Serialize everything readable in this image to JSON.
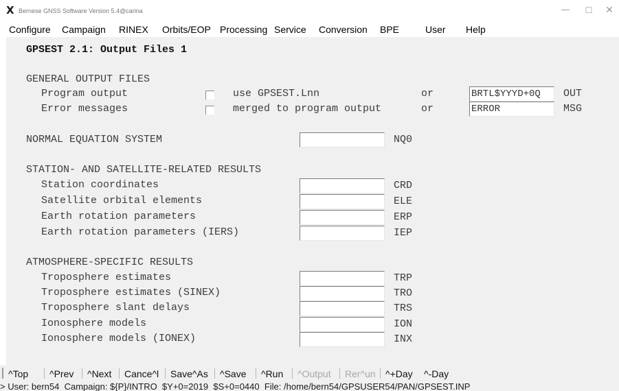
{
  "window": {
    "title": "Bernese GNSS Software Version 5.4@carina",
    "logo_glyph": "X",
    "min_glyph": "—",
    "max_glyph": "☐",
    "close_glyph": "✕"
  },
  "menu": [
    {
      "label": "Configure"
    },
    {
      "label": "Campaign"
    },
    {
      "label": "RINEX"
    },
    {
      "label": "Orbits/EOP"
    },
    {
      "label": "Processing"
    },
    {
      "label": "Service"
    },
    {
      "label": "Conversion"
    },
    {
      "label": "BPE"
    },
    {
      "label": "User"
    },
    {
      "label": "Help"
    }
  ],
  "panel": {
    "title": "GPSEST 2.1: Output Files 1",
    "general": {
      "heading": "GENERAL OUTPUT FILES",
      "program_output": {
        "label": "Program output",
        "option": "use GPSEST.Lnn",
        "or": "or",
        "value": "BRTL$YYYD+0Q",
        "ext": "OUT",
        "checked": false
      },
      "error_messages": {
        "label": "Error messages",
        "option": "merged to program output",
        "or": "or",
        "value": "ERROR",
        "ext": "MSG",
        "checked": false
      }
    },
    "normal_equation": {
      "heading": "NORMAL EQUATION SYSTEM",
      "value": "",
      "ext": "NQ0"
    },
    "station_satellite": {
      "heading": "STATION- AND SATELLITE-RELATED RESULTS",
      "rows": [
        {
          "label": "Station coordinates",
          "value": "",
          "ext": "CRD"
        },
        {
          "label": "Satellite orbital elements",
          "value": "",
          "ext": "ELE"
        },
        {
          "label": "Earth rotation parameters",
          "value": "",
          "ext": "ERP"
        },
        {
          "label": "Earth rotation parameters (IERS)",
          "value": "",
          "ext": "IEP"
        }
      ]
    },
    "atmosphere": {
      "heading": "ATMOSPHERE-SPECIFIC RESULTS",
      "rows": [
        {
          "label": "Troposphere estimates",
          "value": "",
          "ext": "TRP"
        },
        {
          "label": "Troposphere estimates (SINEX)",
          "value": "",
          "ext": "TRO"
        },
        {
          "label": "Troposphere slant delays",
          "value": "",
          "ext": "TRS"
        },
        {
          "label": "Ionosphere models",
          "value": "",
          "ext": "ION"
        },
        {
          "label": "Ionosphere models (IONEX)",
          "value": "",
          "ext": "INX"
        }
      ]
    }
  },
  "toolbar": [
    {
      "label": "^Top",
      "enabled": true
    },
    {
      "label": "^Prev",
      "enabled": true
    },
    {
      "label": "^Next",
      "enabled": true
    },
    {
      "label": "Cance^l",
      "enabled": true
    },
    {
      "label": "Save^As",
      "enabled": true
    },
    {
      "label": "^Save",
      "enabled": true
    },
    {
      "label": "^Run",
      "enabled": true
    },
    {
      "label": "^Output",
      "enabled": false
    },
    {
      "label": "Rer^un",
      "enabled": false
    },
    {
      "label": "^+Day",
      "enabled": true
    },
    {
      "label": "^-Day",
      "enabled": true
    }
  ],
  "status": {
    "text": "> User: bern54  Campaign: ${P}/INTRO  $Y+0=2019  $S+0=0440  File: /home/bern54/GPSUSER54/PAN/GPSEST.INP"
  }
}
